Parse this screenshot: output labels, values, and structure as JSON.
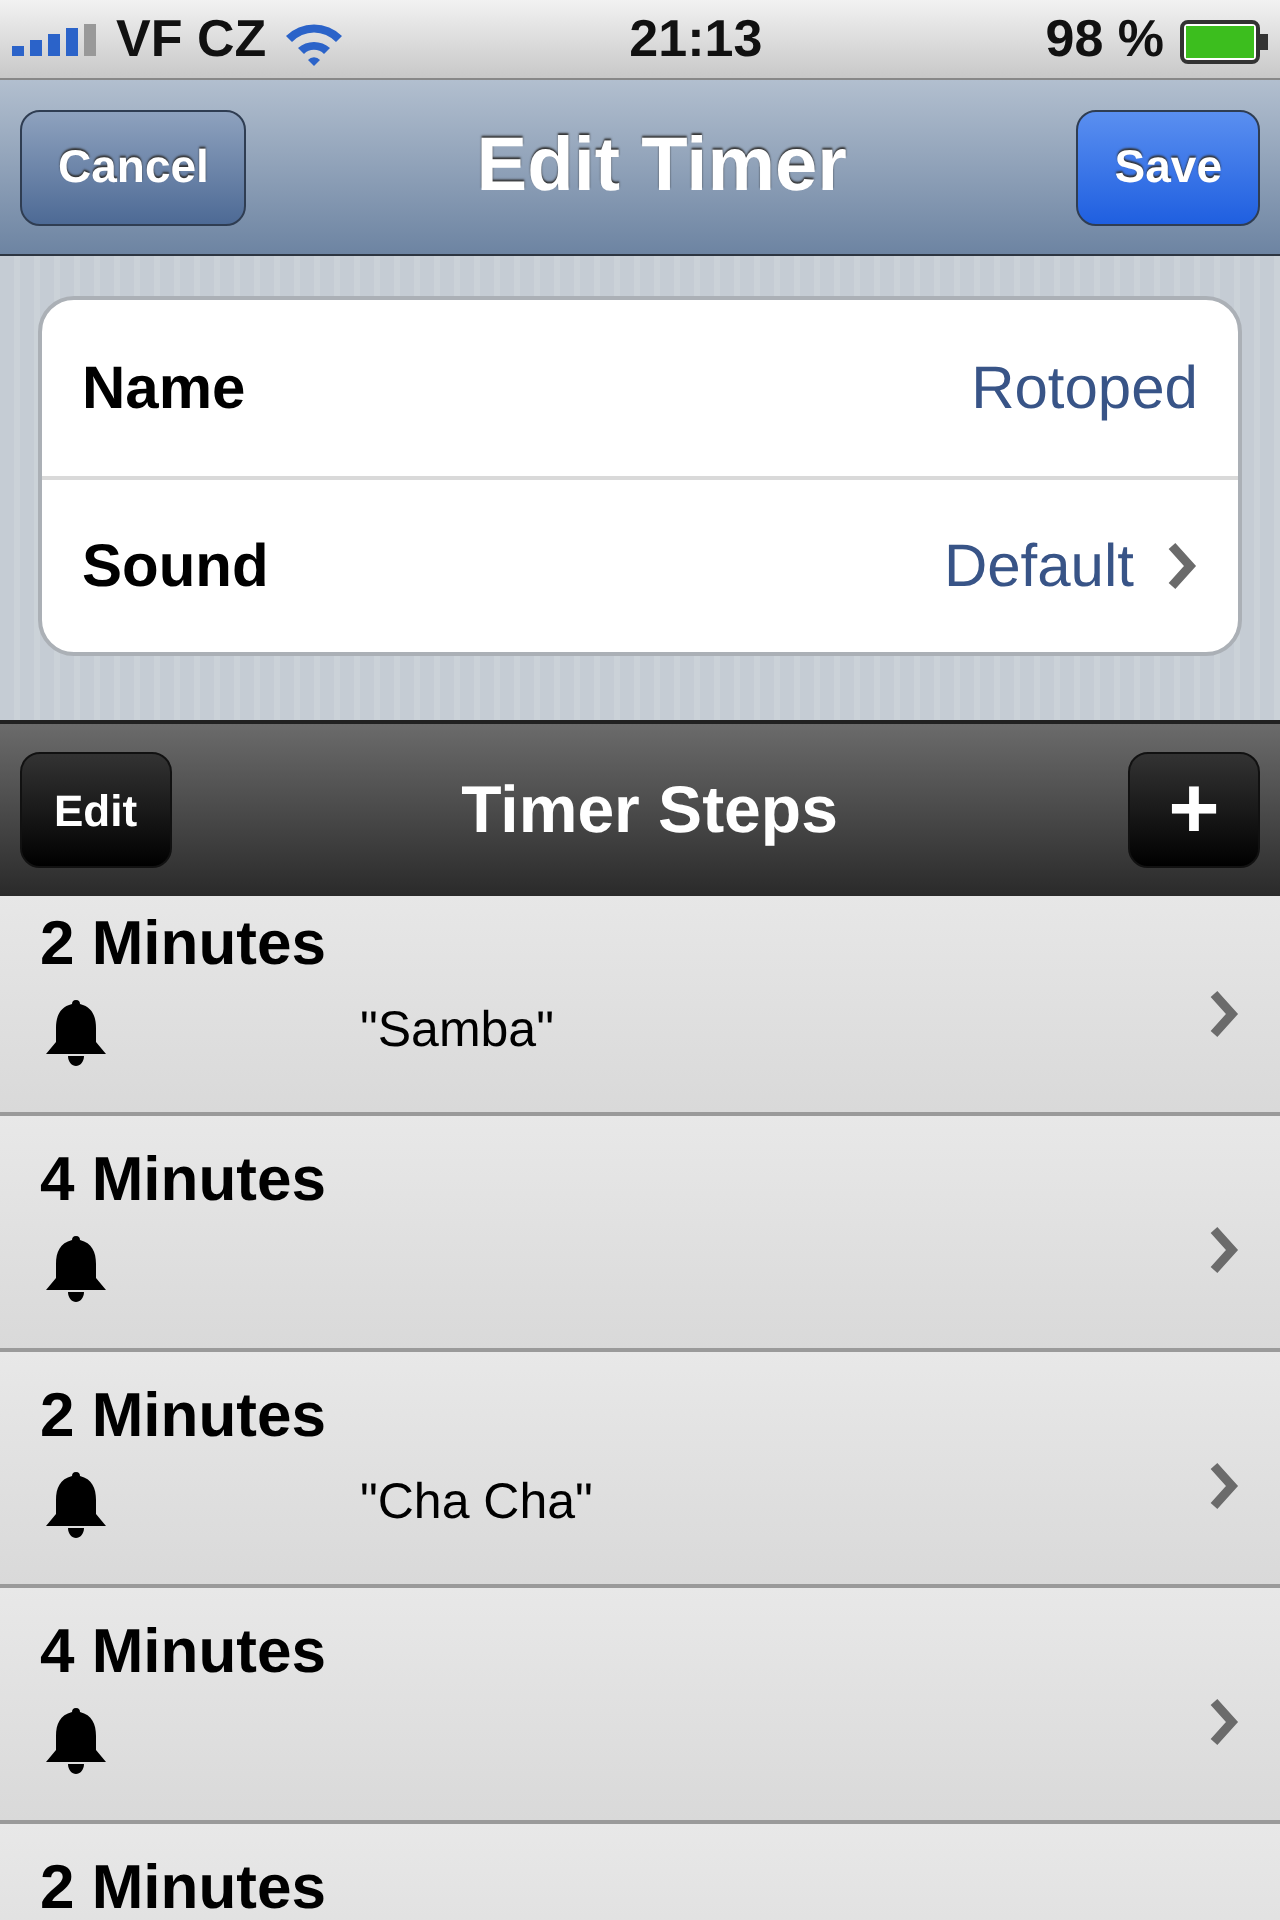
{
  "status_bar": {
    "carrier": "VF CZ",
    "time": "21:13",
    "battery": "98 %"
  },
  "nav_bar": {
    "title": "Edit Timer",
    "left_button": "Cancel",
    "right_button": "Save"
  },
  "settings": [
    {
      "label": "Name",
      "value": "Rotoped",
      "disclosure": false
    },
    {
      "label": "Sound",
      "value": "Default",
      "disclosure": true
    }
  ],
  "toolbar": {
    "title": "Timer Steps",
    "left_button": "Edit",
    "right_button": "+"
  },
  "steps": [
    {
      "title": "2 Minutes",
      "bell": true,
      "disclosure": true,
      "sound": "\"Samba\""
    },
    {
      "title": "4 Minutes",
      "bell": true,
      "disclosure": true
    },
    {
      "title": "2 Minutes",
      "bell": true,
      "disclosure": true,
      "sound": "\"Cha Cha\""
    },
    {
      "title": "4 Minutes",
      "bell": true,
      "disclosure": true
    },
    {
      "title": "2 Minutes"
    }
  ]
}
